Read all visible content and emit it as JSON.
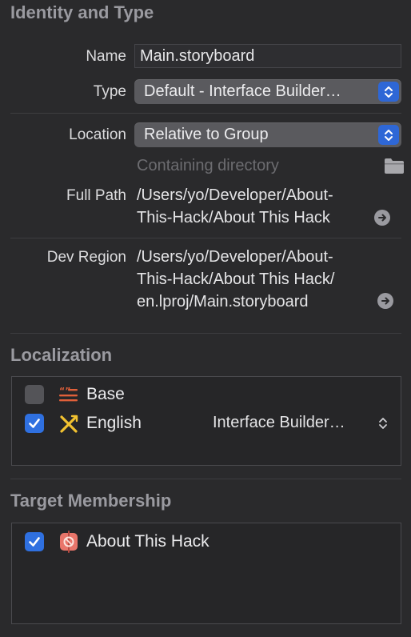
{
  "identity": {
    "section_title": "Identity and Type",
    "name_label": "Name",
    "name_value": "Main.storyboard",
    "type_label": "Type",
    "type_value": "Default - Interface Builder…",
    "location_label": "Location",
    "location_value": "Relative to Group",
    "containing_directory_placeholder": "Containing directory",
    "full_path_label": "Full Path",
    "full_path_lines": [
      "/Users/yo/Developer/About-",
      "This-Hack/About This Hack"
    ],
    "dev_region_label": "Dev Region",
    "dev_region_lines": [
      "/Users/yo/Developer/About-",
      "This-Hack/About This Hack/",
      "en.lproj/Main.storyboard"
    ]
  },
  "localization": {
    "section_title": "Localization",
    "items": [
      {
        "label": "Base",
        "checked": false,
        "icon": "storyboard-strings-icon"
      },
      {
        "label": "English",
        "checked": true,
        "icon": "interface-builder-icon",
        "type_value": "Interface Builder…"
      }
    ]
  },
  "target_membership": {
    "section_title": "Target Membership",
    "items": [
      {
        "label": "About This Hack",
        "checked": true,
        "icon": "app-target-icon"
      }
    ]
  },
  "colors": {
    "background": "#2a2a2c",
    "accent": "#2f70e0",
    "popup": "#5a5a5e"
  }
}
